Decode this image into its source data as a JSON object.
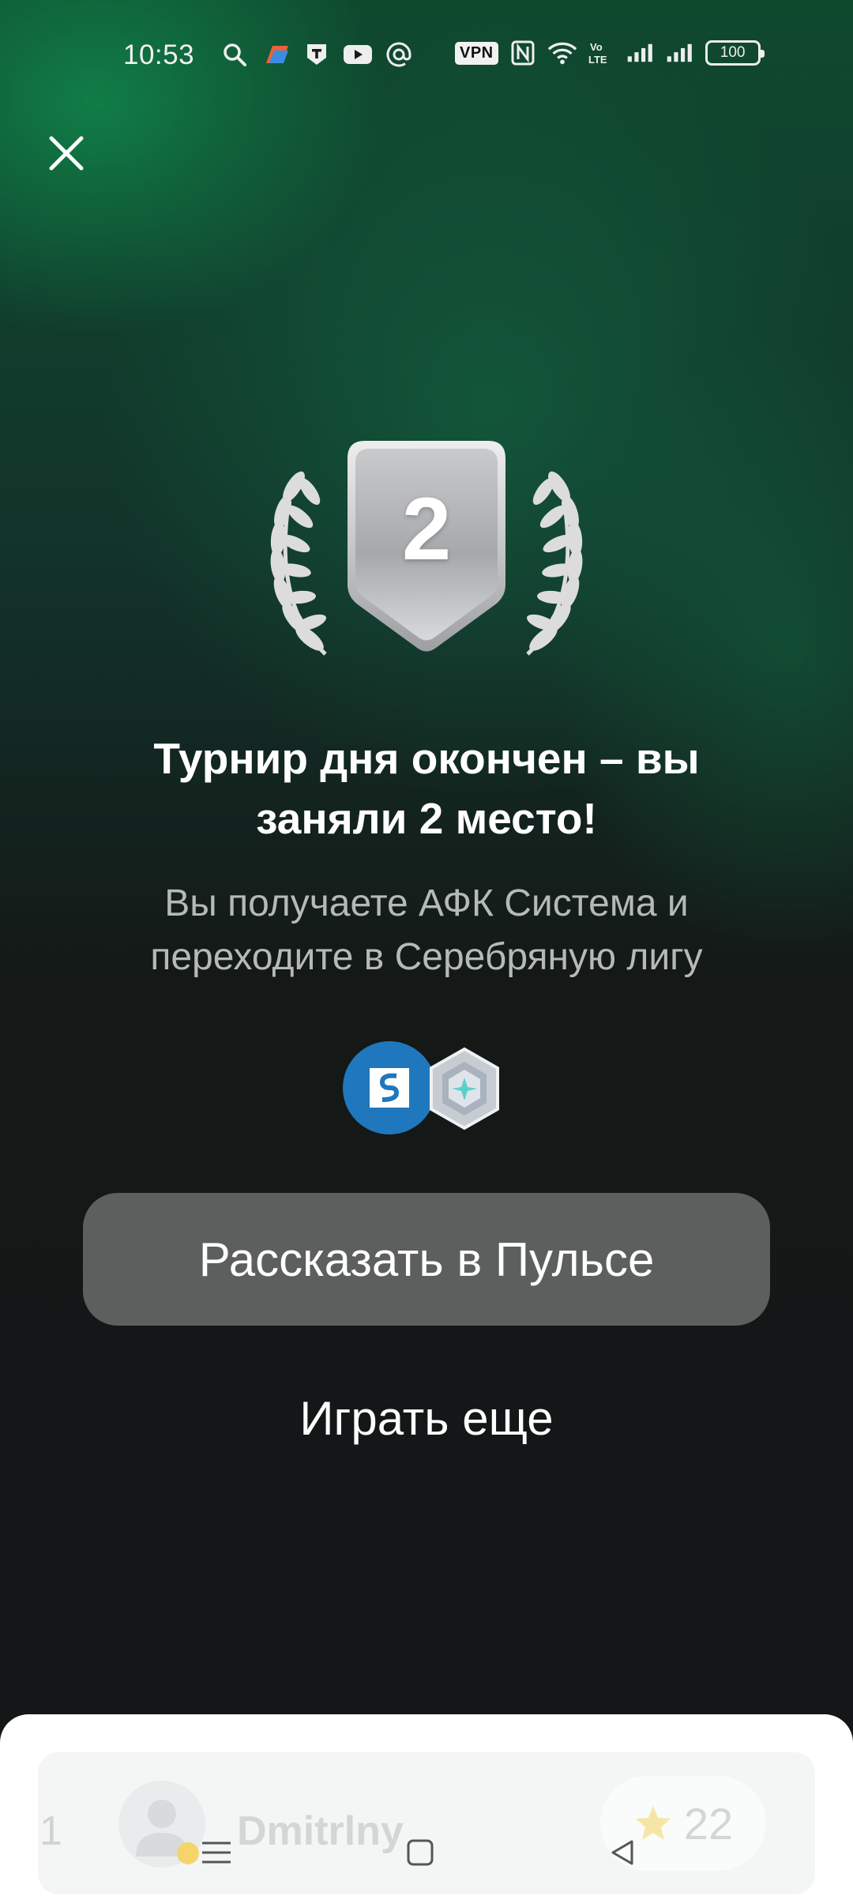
{
  "status_bar": {
    "time": "10:53",
    "vpn": "VPN",
    "battery": "100",
    "icons": [
      "search-icon",
      "app-icon",
      "t-icon",
      "youtube-icon",
      "at-icon",
      "nfc-icon",
      "wifi-icon",
      "volte-icon",
      "signal-icon",
      "signal-icon"
    ]
  },
  "result": {
    "place": "2",
    "title": "Турнир дня окончен – вы заняли 2 место!",
    "subtitle": "Вы получаете АФК Система и переходите в Серебряную лигу"
  },
  "actions": {
    "share_label": "Рассказать в Пульсе",
    "play_again_label": "Играть еще"
  },
  "leaderboard": {
    "rank": "1",
    "name": "Dmitrlny",
    "score": "22"
  },
  "colors": {
    "accent_green": "#108048",
    "button_gray": "#5d5f5f",
    "afk_blue": "#1f78bd"
  }
}
